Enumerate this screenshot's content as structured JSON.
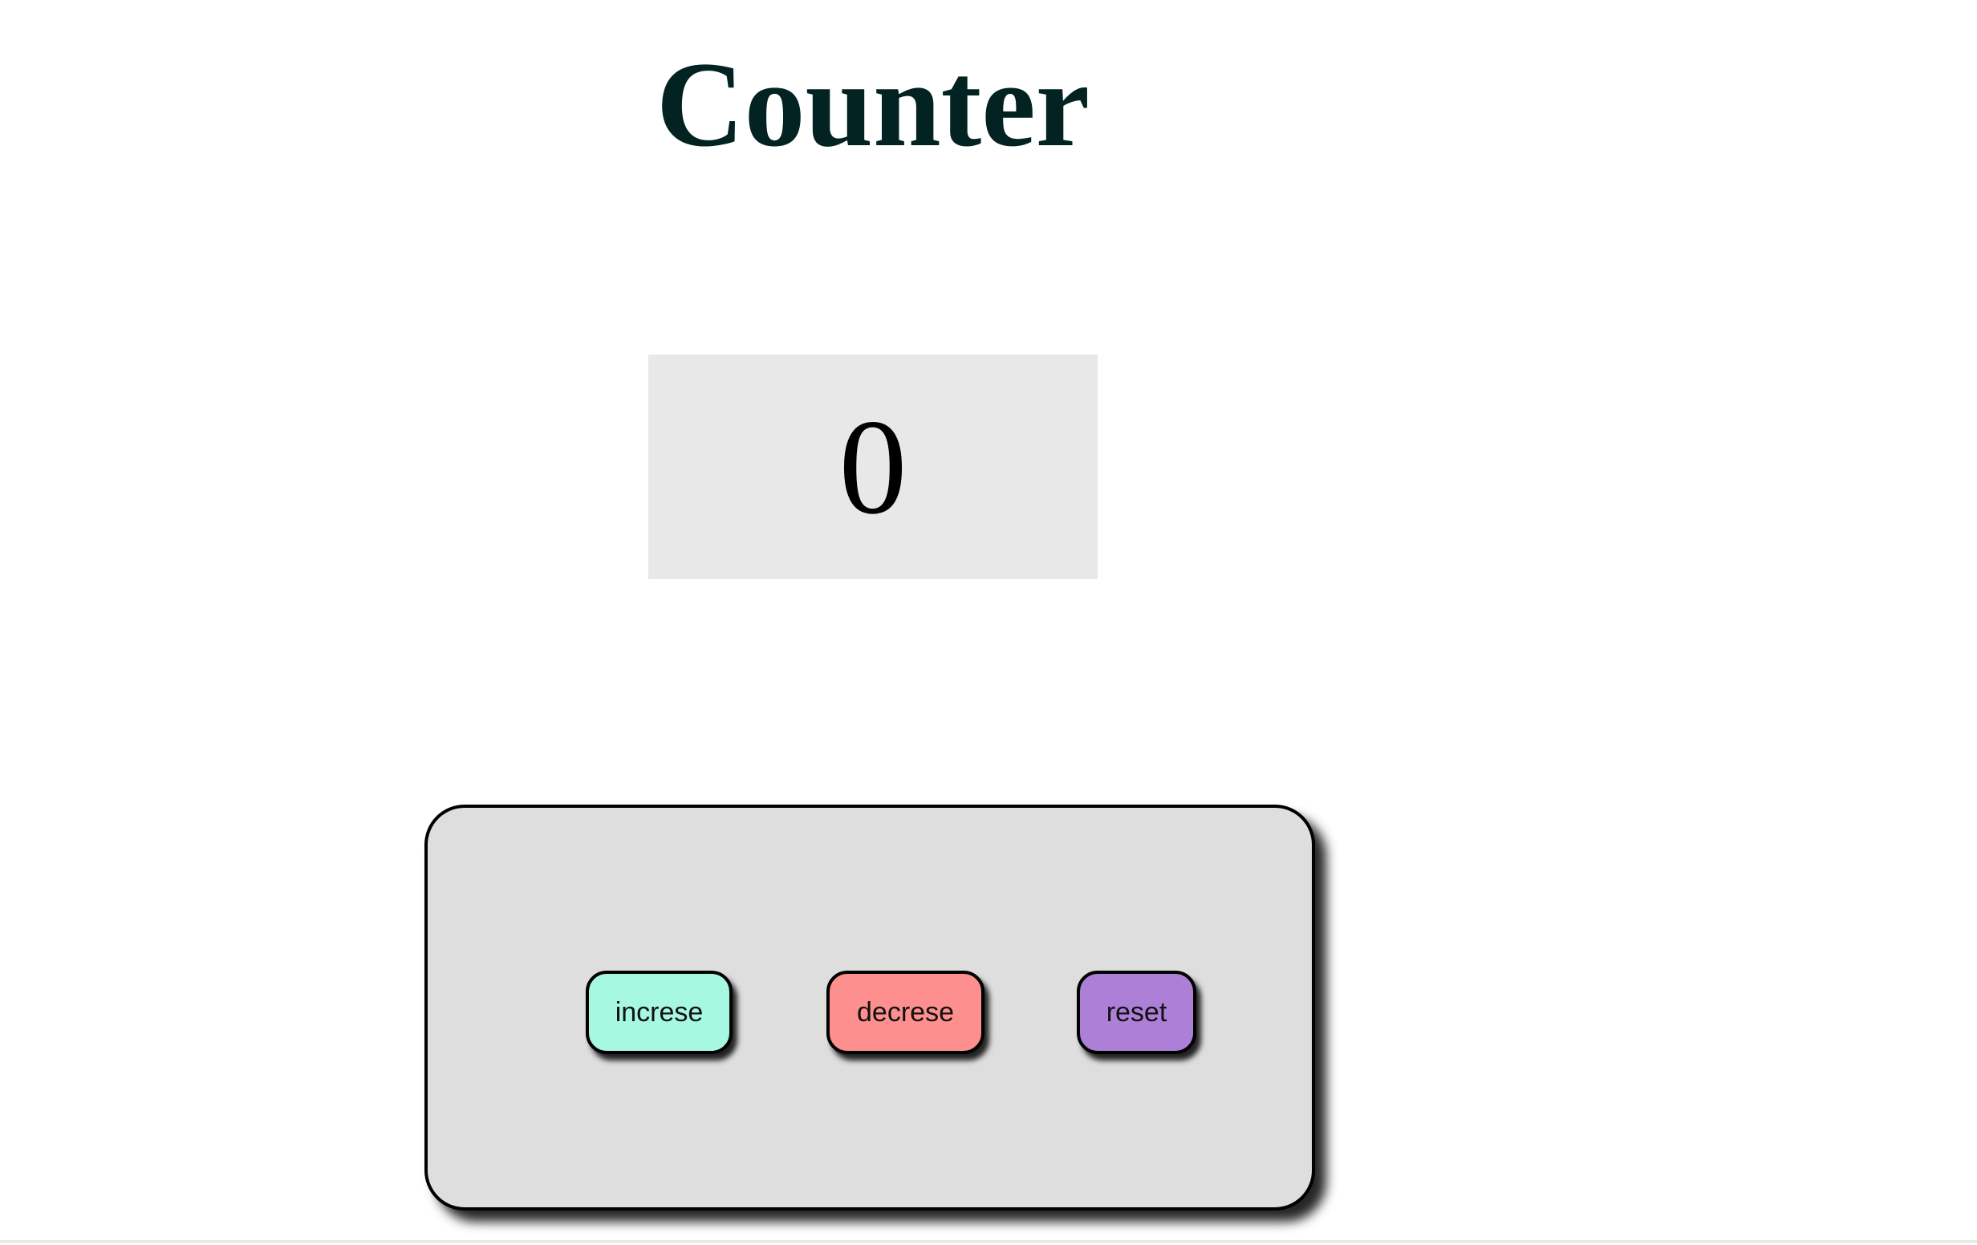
{
  "header": {
    "title": "Counter"
  },
  "counter": {
    "value": "0"
  },
  "controls": {
    "increase_label": "increse",
    "decrease_label": "decrese",
    "reset_label": "reset"
  },
  "colors": {
    "title_text": "#032222",
    "display_background": "#e8e8e8",
    "panel_background": "#dedede",
    "increase_button": "#a6f8e0",
    "decrease_button": "#fe8f8f",
    "reset_button": "#ad7fd6"
  }
}
